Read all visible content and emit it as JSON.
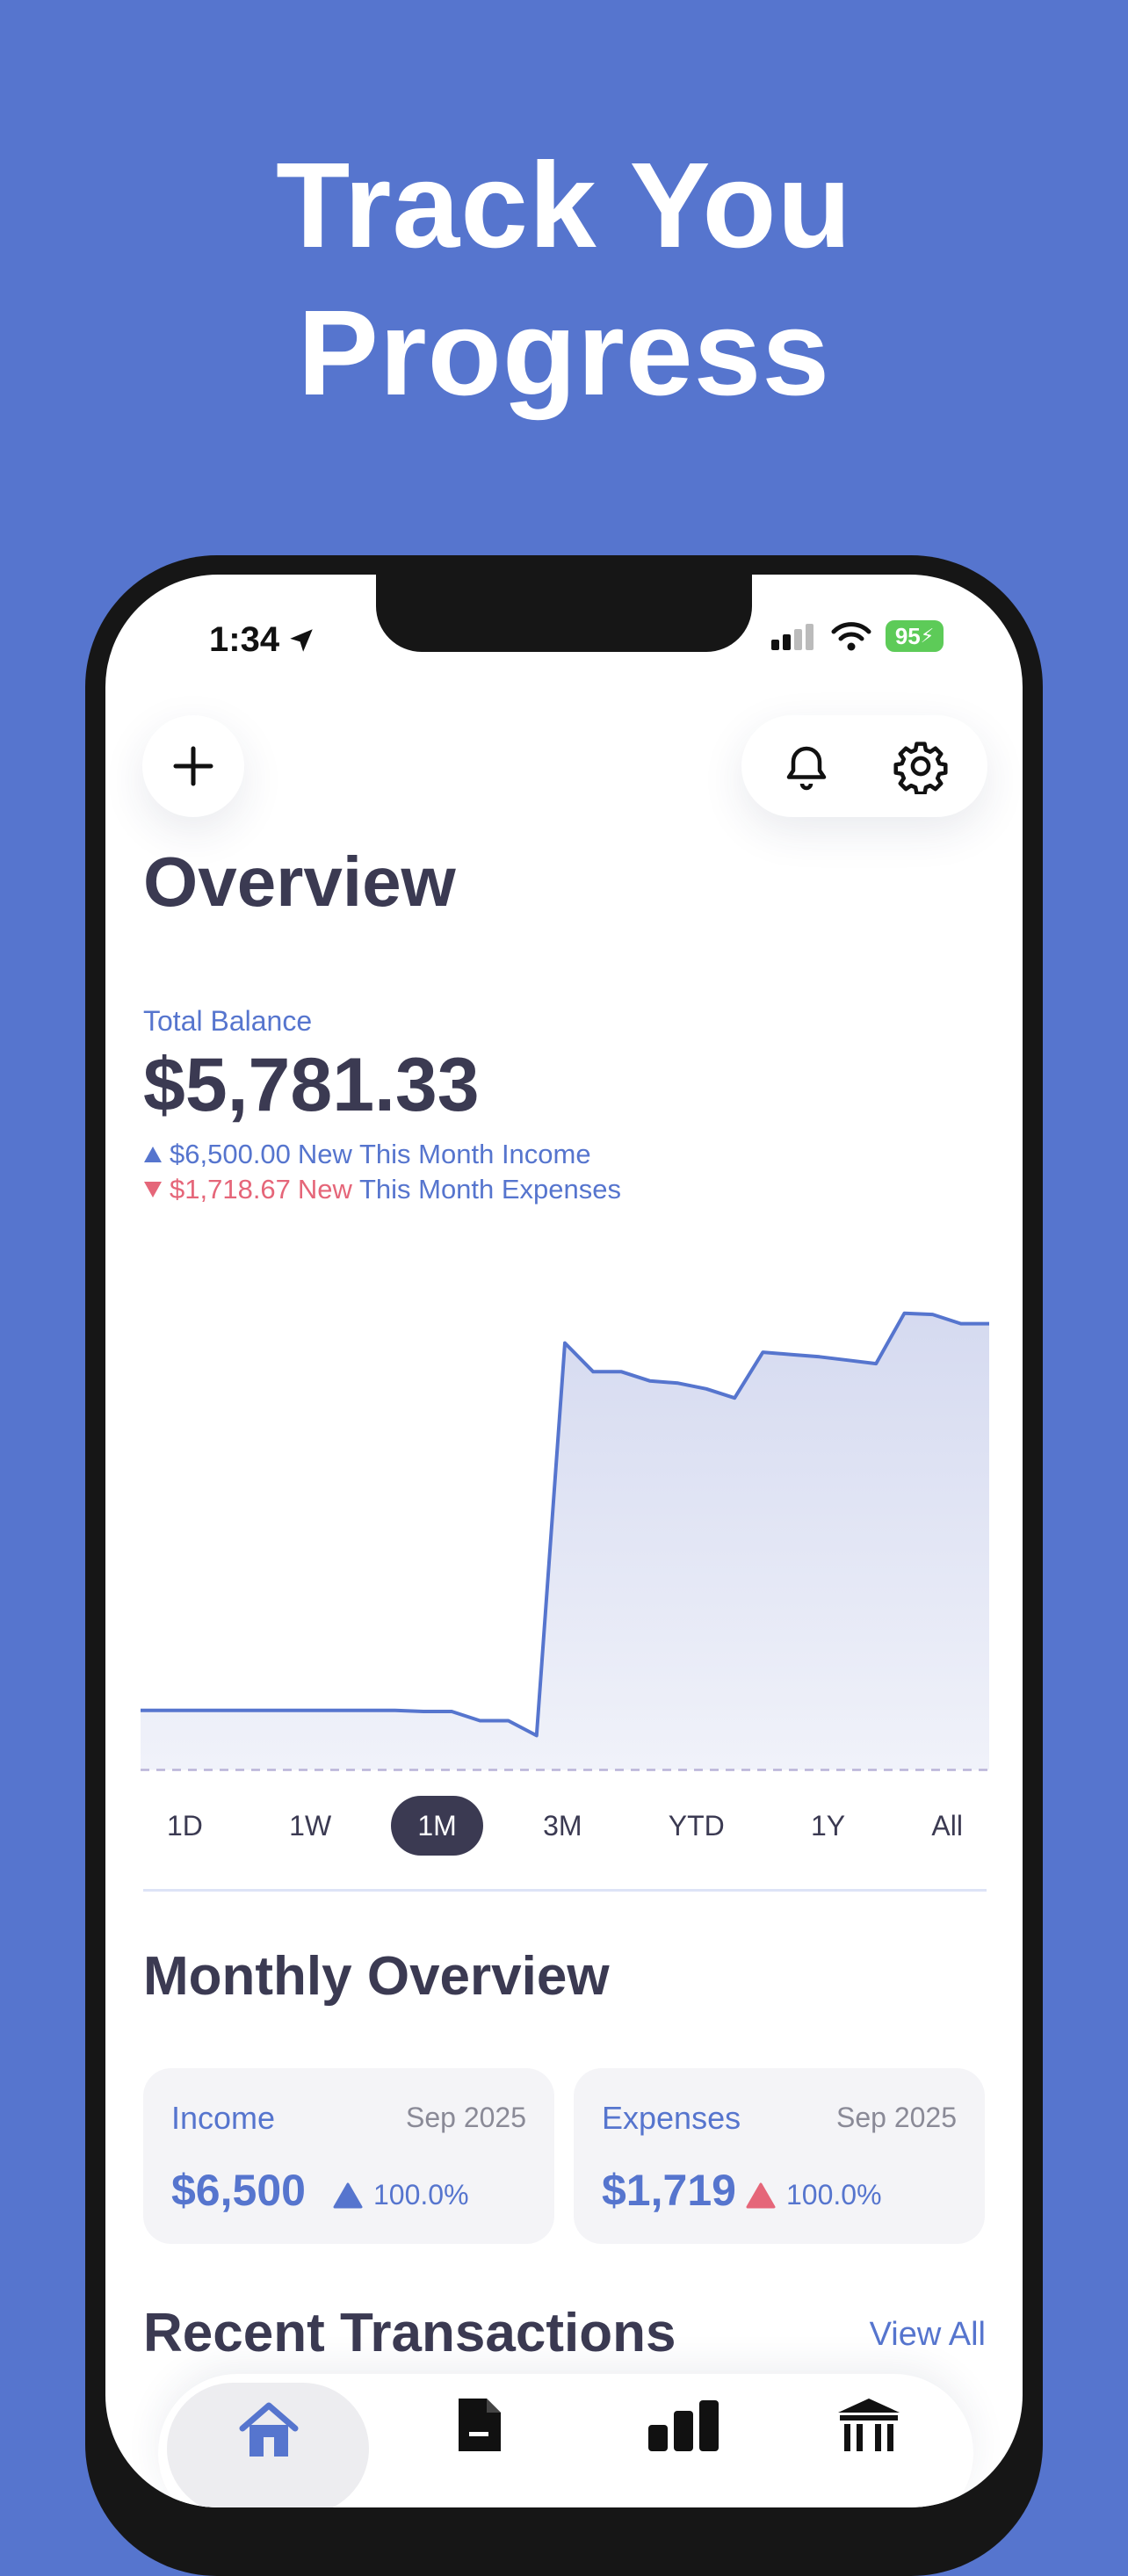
{
  "headline": [
    "Track You",
    "Progress"
  ],
  "status_bar": {
    "time": "1:34",
    "battery": "95"
  },
  "page": {
    "title": "Overview"
  },
  "balance": {
    "label": "Total Balance",
    "value": "$5,781.33",
    "income_amount": "$6,500.00",
    "income_text": "New This Month Income",
    "expense_amount": "$1,718.67",
    "expense_new": "New",
    "expense_text": "This Month Expenses"
  },
  "chart_data": {
    "type": "area",
    "x": [
      1,
      2,
      3,
      4,
      5,
      6,
      7,
      8,
      9,
      10,
      11,
      12,
      13,
      14,
      15,
      16,
      17,
      18,
      19,
      20,
      21,
      22,
      23,
      24,
      25,
      26,
      27,
      28,
      29,
      30,
      31
    ],
    "values": [
      2570,
      2570,
      2570,
      2570,
      2570,
      2570,
      2570,
      2570,
      2570,
      2570,
      2560,
      2560,
      2480,
      2480,
      2350,
      5781,
      5530,
      5530,
      5450,
      5430,
      5380,
      5300,
      5700,
      5680,
      5660,
      5630,
      5600,
      6040,
      6030,
      5950,
      5950
    ],
    "baseline": 2050,
    "ylim": [
      1900,
      6200
    ],
    "line_color": "#5675CE",
    "fill_color": "#D5DAF0"
  },
  "ranges": {
    "items": [
      "1D",
      "1W",
      "1M",
      "3M",
      "YTD",
      "1Y",
      "All"
    ],
    "selected": "1M"
  },
  "monthly": {
    "title": "Monthly Overview",
    "income": {
      "label": "Income",
      "date": "Sep 2025",
      "value": "$6,500",
      "pct": "100.0%"
    },
    "expenses": {
      "label": "Expenses",
      "date": "Sep 2025",
      "value": "$1,719",
      "pct": "100.0%"
    }
  },
  "transactions": {
    "title": "Recent Transactions",
    "view_all": "View All"
  },
  "tabbar": {
    "icons": [
      "home-icon",
      "document-icon",
      "bar-chart-icon",
      "bank-icon"
    ]
  },
  "colors": {
    "accent": "#5675CE",
    "dark_text": "#3B3A52",
    "expense": "#E56679",
    "background": "#5675CE"
  }
}
